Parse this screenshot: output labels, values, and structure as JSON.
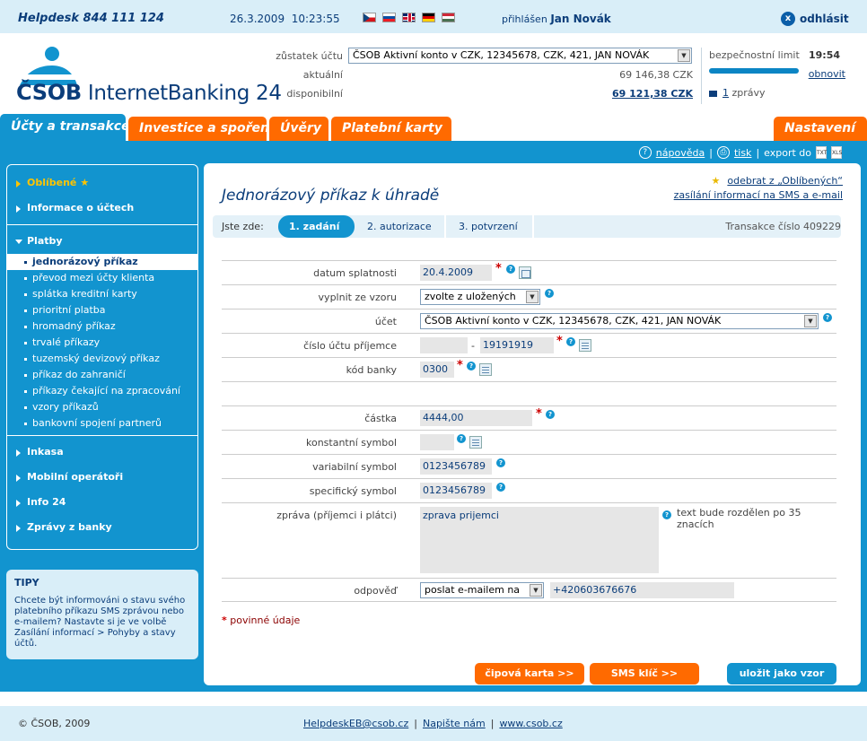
{
  "topbar": {
    "helpdesk": "Helpdesk 844 111 124",
    "datetime": "26.3.2009  10:23:55",
    "logged_prefix": "přihlášen",
    "user": "Jan Novák",
    "logout": "odhlásit"
  },
  "header": {
    "logo_brand": "ČSOB",
    "logo_product": "InternetBanking 24",
    "balance_label": "zůstatek účtu",
    "account_select": "ČSOB Aktivní konto v CZK, 12345678, CZK, 421, JAN NOVÁK",
    "current_label": "aktuální",
    "current_value": "69 146,38 CZK",
    "available_label": "disponibilní",
    "available_value": "69 121,38 CZK",
    "security_label": "bezpečnostní limit",
    "security_time": "19:54",
    "security_progress": 1.0,
    "refresh": "obnovit",
    "messages_count": "1",
    "messages_label": "zprávy"
  },
  "nav": {
    "tabs": [
      {
        "label": "Účty a transakce"
      },
      {
        "label": "Investice a spoření"
      },
      {
        "label": "Úvěry"
      },
      {
        "label": "Platební karty"
      }
    ],
    "settings": "Nastavení"
  },
  "tools": {
    "help": "nápověda",
    "print": "tisk",
    "export": "export do",
    "txt": "TXT",
    "xls": "XLS"
  },
  "sidebar": {
    "favorites": "Oblíbené",
    "account_info": "Informace o účtech",
    "payments": "Platby",
    "payment_items": [
      "jednorázový příkaz",
      "převod mezi účty klienta",
      "splátka kreditní karty",
      "prioritní platba",
      "hromadný příkaz",
      "trvalé příkazy",
      "tuzemský devizový příkaz",
      "příkaz do zahraničí",
      "příkazy čekající na zpracování",
      "vzory příkazů",
      "bankovní spojení partnerů"
    ],
    "collections": "Inkasa",
    "mobile": "Mobilní operátoři",
    "info24": "Info 24",
    "bank_messages": "Zprávy z banky"
  },
  "tips": {
    "title": "TIPY",
    "text": "Chcete být informováni o stavu svého platebního příkazu SMS zprávou nebo e-mailem? Nastavte si je ve volbě Zasílání informací > Pohyby a stavy účtů."
  },
  "page": {
    "title": "Jednorázový příkaz k úhradě",
    "remove_fav": "odebrat z „Oblíbených“",
    "sms_info": "zasílání informací na SMS a e-mail",
    "you_are_here": "Jste zde:",
    "steps": [
      "1. zadání",
      "2. autorizace",
      "3. potvrzení"
    ],
    "transaction": "Transakce číslo 409229"
  },
  "form": {
    "due_date_label": "datum splatnosti",
    "due_date": "20.4.2009",
    "template_label": "vyplnit ze vzoru",
    "template_value": "zvolte z uložených",
    "account_label": "účet",
    "account_value": "ČSOB Aktivní konto v CZK, 12345678, CZK, 421, JAN NOVÁK",
    "recipient_label": "číslo účtu příjemce",
    "recipient_prefix": "",
    "recipient_number": "19191919",
    "bank_code_label": "kód banky",
    "bank_code": "0300",
    "amount_label": "částka",
    "amount": "4444,00",
    "const_label": "konstantní symbol",
    "const_value": "",
    "var_label": "variabilní symbol",
    "var_value": "0123456789",
    "spec_label": "specifický symbol",
    "spec_value": "0123456789",
    "message_label": "zpráva (příjemci i plátci)",
    "message_value": "zprava prijemci",
    "message_note": "text bude rozdělen po 35 znacích",
    "reply_label": "odpověď",
    "reply_value": "poslat e-mailem na",
    "reply_contact": "+420603676676",
    "required_note": "povinné údaje",
    "btn_chip": "čipová karta >>",
    "btn_sms": "SMS klíč >>",
    "btn_save": "uložit jako vzor"
  },
  "footer": {
    "copyright": "© ČSOB, 2009",
    "email": "HelpdeskEB@csob.cz",
    "write": "Napište nám",
    "web": "www.csob.cz"
  }
}
